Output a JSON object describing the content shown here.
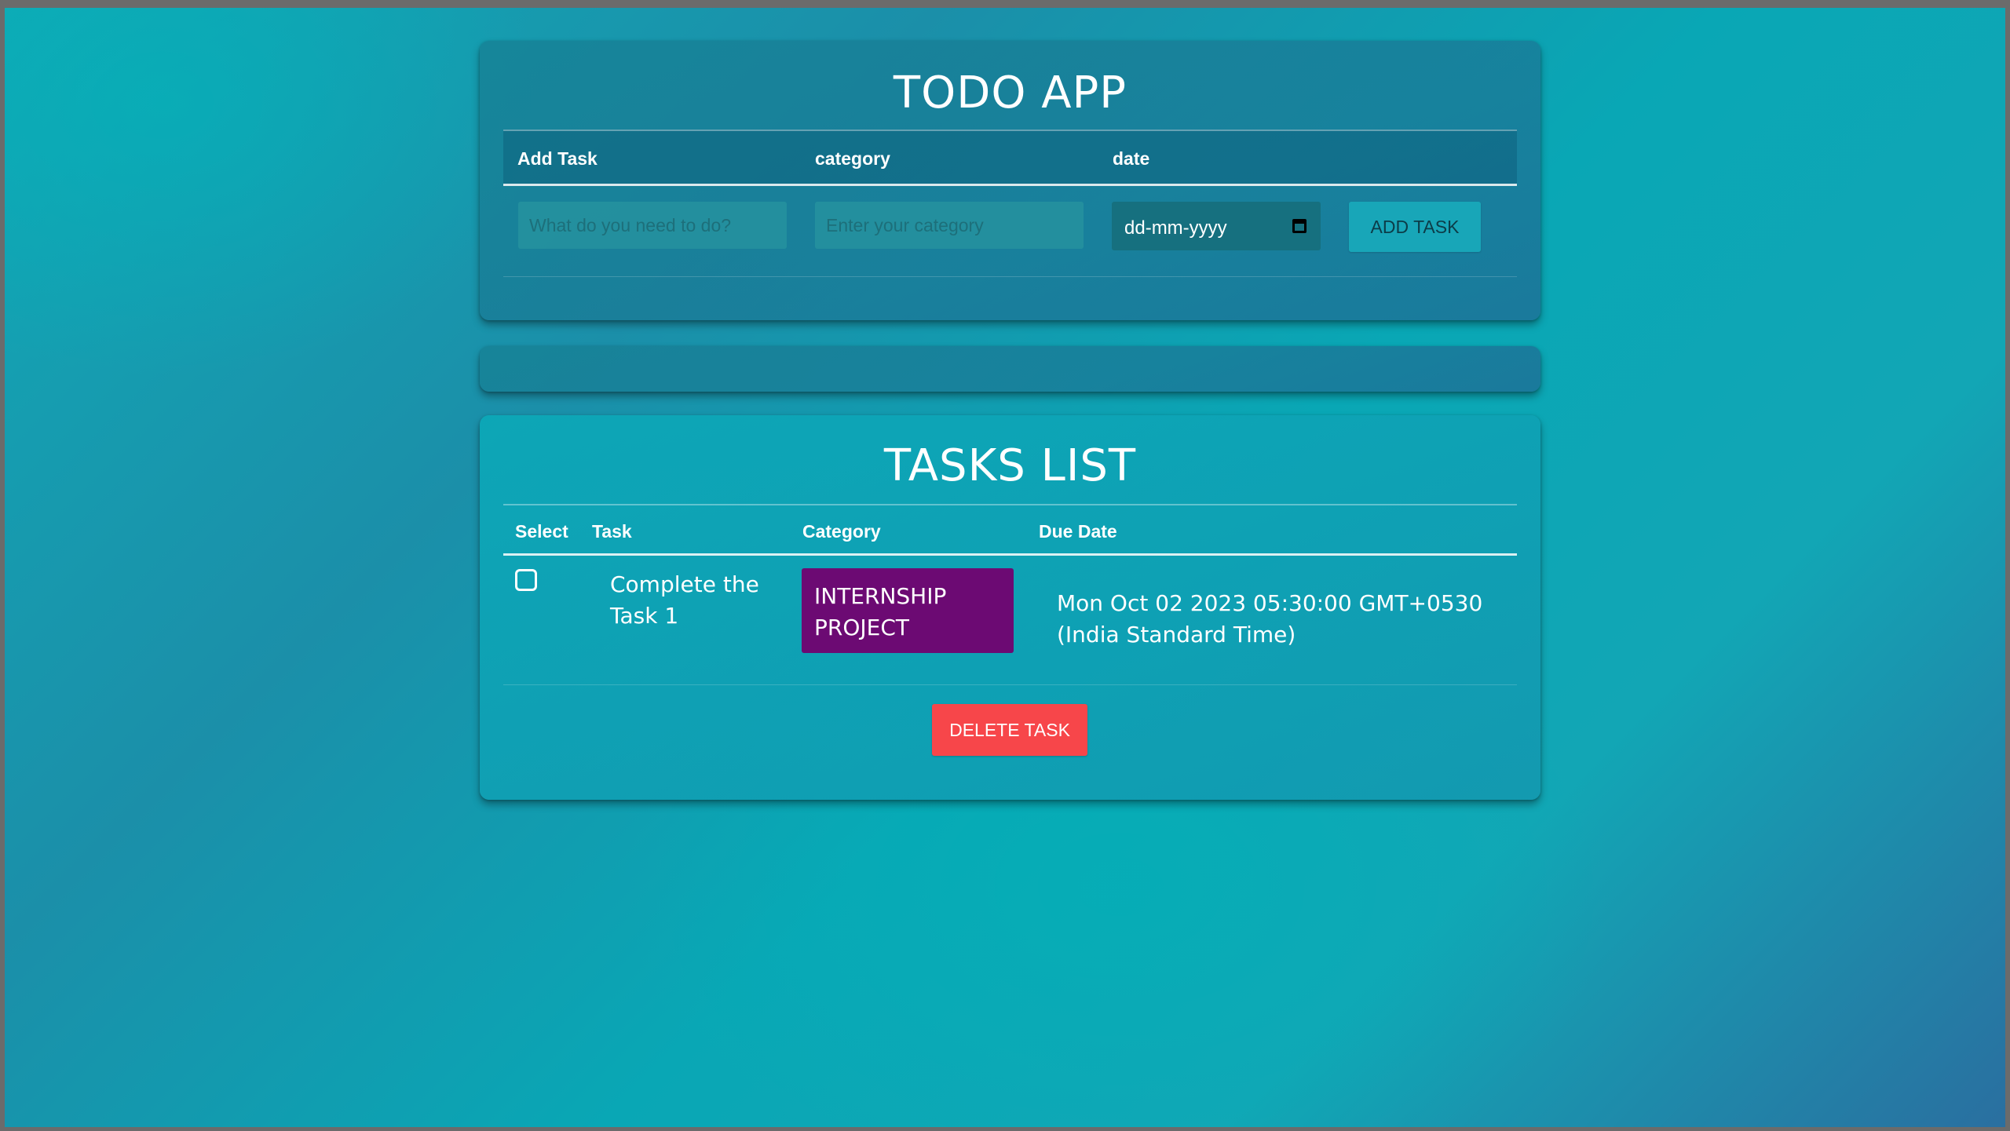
{
  "app": {
    "title": "TODO APP"
  },
  "form": {
    "headers": {
      "task": "Add Task",
      "category": "category",
      "date": "date"
    },
    "task_placeholder": "What do you need to do?",
    "category_placeholder": "Enter your category",
    "date_value": "dd-mm-yyyy",
    "add_button": "ADD TASK"
  },
  "tasks": {
    "title": "TASKS LIST",
    "headers": {
      "select": "Select",
      "task": "Task",
      "category": "Category",
      "due": "Due Date"
    },
    "rows": [
      {
        "selected": false,
        "task": "Complete the Task 1",
        "category": "INTERNSHIP PROJECT",
        "due": "Mon Oct 02 2023 05:30:00 GMT+0530 (India Standard Time)"
      }
    ],
    "delete_button": "DELETE TASK"
  },
  "colors": {
    "category_badge": "#6c0a73",
    "delete_button": "#f7464a",
    "add_button": "#18a6b8"
  }
}
